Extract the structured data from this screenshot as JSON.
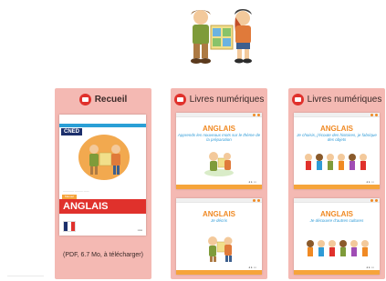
{
  "columns": [
    {
      "header": "Recueil",
      "caption": "(PDF, 6.7 Mo, à télécharger)"
    },
    {
      "header": "Livres numériques"
    },
    {
      "header": "Livres numériques"
    }
  ],
  "cover": {
    "logo": "CNED",
    "tag": "Manuel",
    "title": "ANGLAIS"
  },
  "books": [
    {
      "title": "ANGLAIS",
      "subtitle": "Apprends les nouveaux mots sur le thème de la préparation"
    },
    {
      "title": "ANGLAIS",
      "subtitle": "Je choisis, j'écoute des histoires, je fabrique des objets"
    },
    {
      "title": "ANGLAIS",
      "subtitle": "Je décris"
    },
    {
      "title": "ANGLAIS",
      "subtitle": "Je découvre d'autres cultures"
    }
  ],
  "colors": {
    "panel": "#f4b9b3",
    "icon": "#e0312c",
    "accent_orange": "#f08a24",
    "accent_blue": "#2f9bd7"
  },
  "icons": [
    "book-icon",
    "book-icon",
    "book-icon"
  ]
}
